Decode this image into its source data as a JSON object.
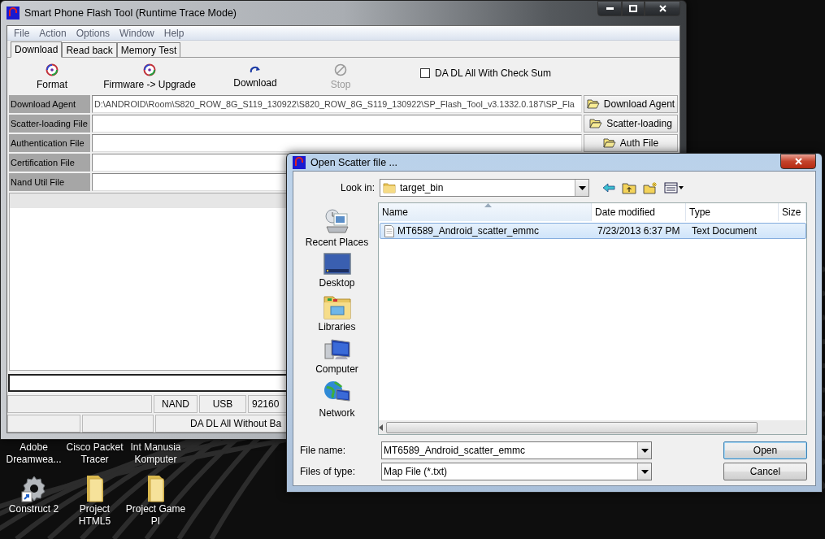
{
  "desktop": {
    "icons": [
      {
        "label": "Adobe Dreamwea...",
        "kind": "covered"
      },
      {
        "label": "Cisco Packet Tracer",
        "kind": "covered"
      },
      {
        "label": "Int Manusia Komputer",
        "kind": "covered"
      },
      {
        "label": "Construct 2",
        "kind": "gear"
      },
      {
        "label": "Project HTML5",
        "kind": "folder"
      },
      {
        "label": "Project Game PI",
        "kind": "folder"
      }
    ]
  },
  "main_window": {
    "title": "Smart Phone Flash Tool (Runtime Trace Mode)",
    "menu": [
      "File",
      "Action",
      "Options",
      "Window",
      "Help"
    ],
    "tabs": [
      {
        "label": "Download",
        "selected": true
      },
      {
        "label": "Read back",
        "selected": false
      },
      {
        "label": "Memory Test",
        "selected": false
      }
    ],
    "toolbar": [
      {
        "label": "Format",
        "kind": "format",
        "disabled": false
      },
      {
        "label": "Firmware -> Upgrade",
        "kind": "upgrade",
        "disabled": false
      },
      {
        "label": "Download",
        "kind": "download",
        "disabled": false
      },
      {
        "label": "Stop",
        "kind": "stop",
        "disabled": true
      }
    ],
    "checksum_option": {
      "label": "DA DL All With Check Sum",
      "checked": false
    },
    "fields": [
      {
        "label": "Download Agent",
        "value": "D:\\ANDROID\\Room\\S820_ROW_8G_S119_130922\\S820_ROW_8G_S119_130922\\SP_Flash_Tool_v3.1332.0.187\\SP_Fla",
        "button": "Download Agent"
      },
      {
        "label": "Scatter-loading File",
        "button": "Scatter-loading"
      },
      {
        "label": "Authentication File",
        "button": "Auth File"
      },
      {
        "label": "Certification File"
      },
      {
        "label": "Nand Util File"
      }
    ],
    "status_bar": {
      "row_1": [
        "NAND",
        "USB",
        "92160"
      ],
      "row_2": [
        "DA DL All Without Ba"
      ]
    }
  },
  "dialog": {
    "title": "Open Scatter file ...",
    "look_in": {
      "label": "Look in:",
      "value": "target_bin"
    },
    "places": [
      {
        "label": "Recent Places",
        "kind": "recent"
      },
      {
        "label": "Desktop",
        "kind": "desktop"
      },
      {
        "label": "Libraries",
        "kind": "libraries"
      },
      {
        "label": "Computer",
        "kind": "computer"
      },
      {
        "label": "Network",
        "kind": "network"
      }
    ],
    "columns": [
      {
        "label": "Name",
        "sorted": true
      },
      {
        "label": "Date modified",
        "sorted": false
      },
      {
        "label": "Type",
        "sorted": false
      },
      {
        "label": "Size",
        "sorted": false
      }
    ],
    "rows": [
      {
        "name": "MT6589_Android_scatter_emmc",
        "date": "7/23/2013 6:37 PM",
        "type": "Text Document",
        "selected": true
      }
    ],
    "file_name": {
      "label": "File name:",
      "value": "MT6589_Android_scatter_emmc"
    },
    "file_type": {
      "label": "Files of type:",
      "value": "Map File (*.txt)"
    },
    "buttons": [
      {
        "label": "Open",
        "default": true
      },
      {
        "label": "Cancel",
        "default": false
      }
    ]
  }
}
